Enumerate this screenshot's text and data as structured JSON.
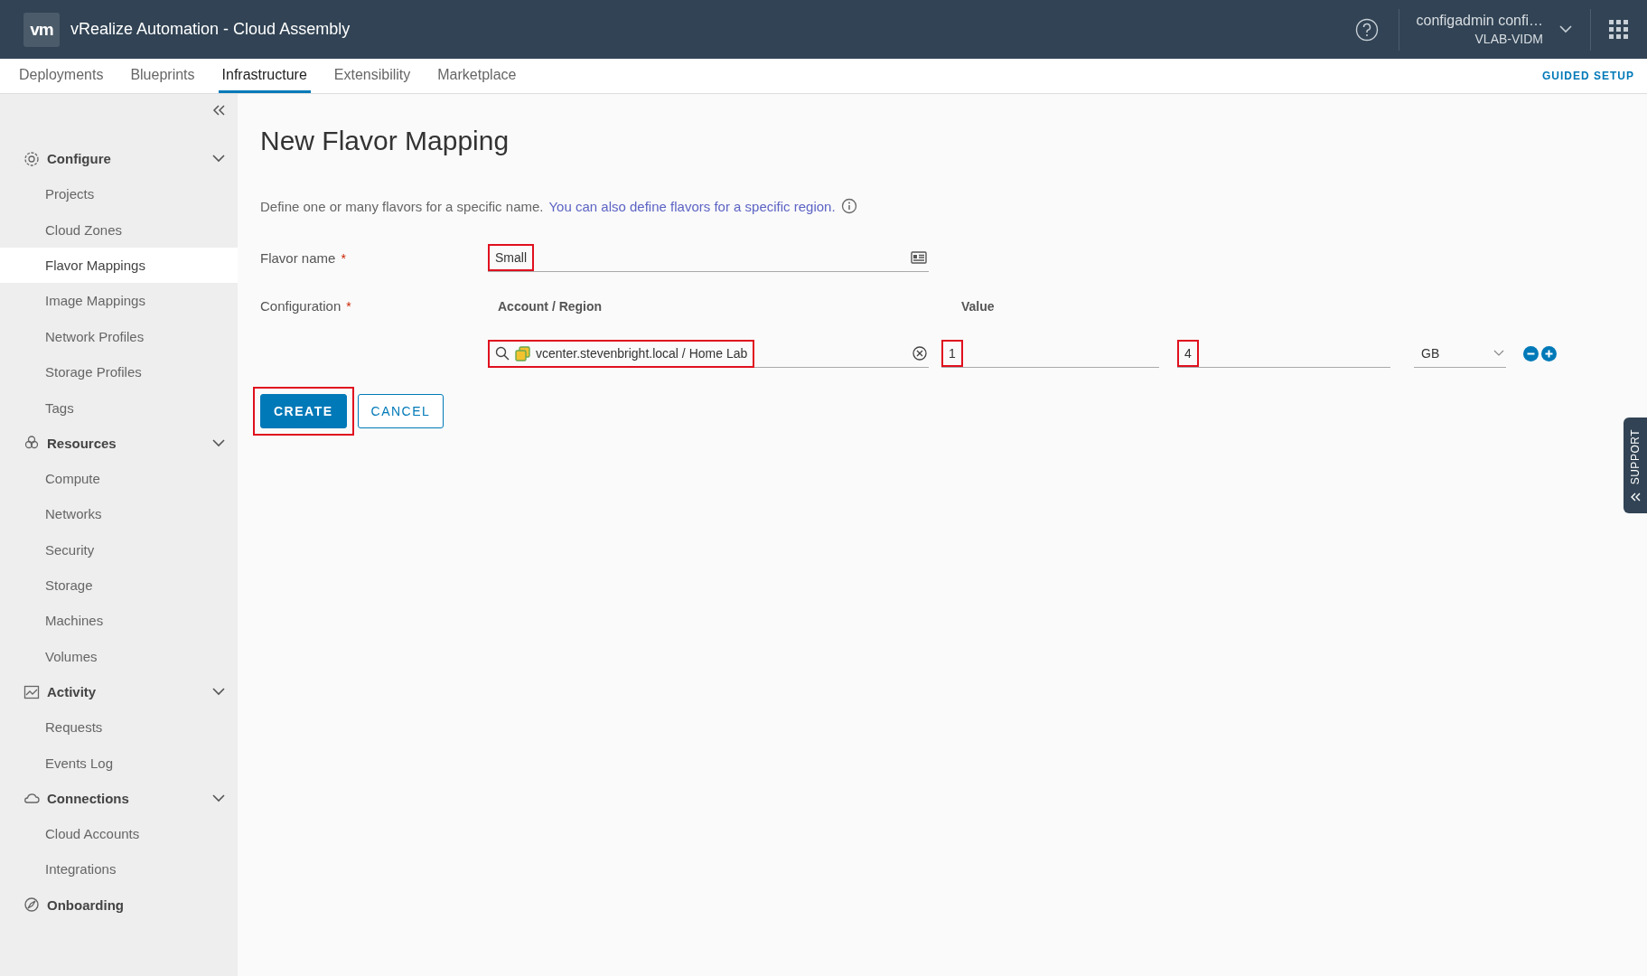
{
  "header": {
    "logo": "vm",
    "title": "vRealize Automation - Cloud Assembly",
    "user": "configadmin confi…",
    "org": "VLAB-VIDM"
  },
  "tabs": [
    {
      "label": "Deployments",
      "selected": false
    },
    {
      "label": "Blueprints",
      "selected": false
    },
    {
      "label": "Infrastructure",
      "selected": true
    },
    {
      "label": "Extensibility",
      "selected": false
    },
    {
      "label": "Marketplace",
      "selected": false
    }
  ],
  "guided_setup": "GUIDED SETUP",
  "sidebar": {
    "sections": [
      {
        "title": "Configure",
        "kind": "group",
        "items": [
          {
            "label": "Projects",
            "selected": false
          },
          {
            "label": "Cloud Zones",
            "selected": false
          },
          {
            "label": "Flavor Mappings",
            "selected": true
          },
          {
            "label": "Image Mappings",
            "selected": false
          },
          {
            "label": "Network Profiles",
            "selected": false
          },
          {
            "label": "Storage Profiles",
            "selected": false
          },
          {
            "label": "Tags",
            "selected": false
          }
        ]
      },
      {
        "title": "Resources",
        "kind": "group",
        "items": [
          {
            "label": "Compute",
            "selected": false
          },
          {
            "label": "Networks",
            "selected": false
          },
          {
            "label": "Security",
            "selected": false
          },
          {
            "label": "Storage",
            "selected": false
          },
          {
            "label": "Machines",
            "selected": false
          },
          {
            "label": "Volumes",
            "selected": false
          }
        ]
      },
      {
        "title": "Activity",
        "kind": "group",
        "items": [
          {
            "label": "Requests",
            "selected": false
          },
          {
            "label": "Events Log",
            "selected": false
          }
        ]
      },
      {
        "title": "Connections",
        "kind": "group",
        "items": [
          {
            "label": "Cloud Accounts",
            "selected": false
          },
          {
            "label": "Integrations",
            "selected": false
          }
        ]
      },
      {
        "title": "Onboarding",
        "kind": "link"
      }
    ]
  },
  "form": {
    "title": "New Flavor Mapping",
    "description": "Define one or many flavors for a specific name.",
    "description_link": "You can also define flavors for a specific region.",
    "flavor_name": {
      "label": "Flavor name",
      "required_mark": "*",
      "value": "Small",
      "highlighted": true
    },
    "configuration": {
      "label": "Configuration",
      "required_mark": "*",
      "account_header": "Account / Region",
      "value_header": "Value",
      "rows": [
        {
          "account": "vcenter.stevenbright.local / Home Lab",
          "account_highlighted": true,
          "cpu": "1",
          "cpu_highlighted": true,
          "memory": "4",
          "memory_highlighted": true,
          "unit": "GB"
        }
      ]
    },
    "buttons": [
      {
        "label": "CREATE",
        "kind": "primary",
        "highlighted": true
      },
      {
        "label": "CANCEL",
        "kind": "secondary",
        "highlighted": false
      }
    ]
  },
  "support_tab": "SUPPORT"
}
